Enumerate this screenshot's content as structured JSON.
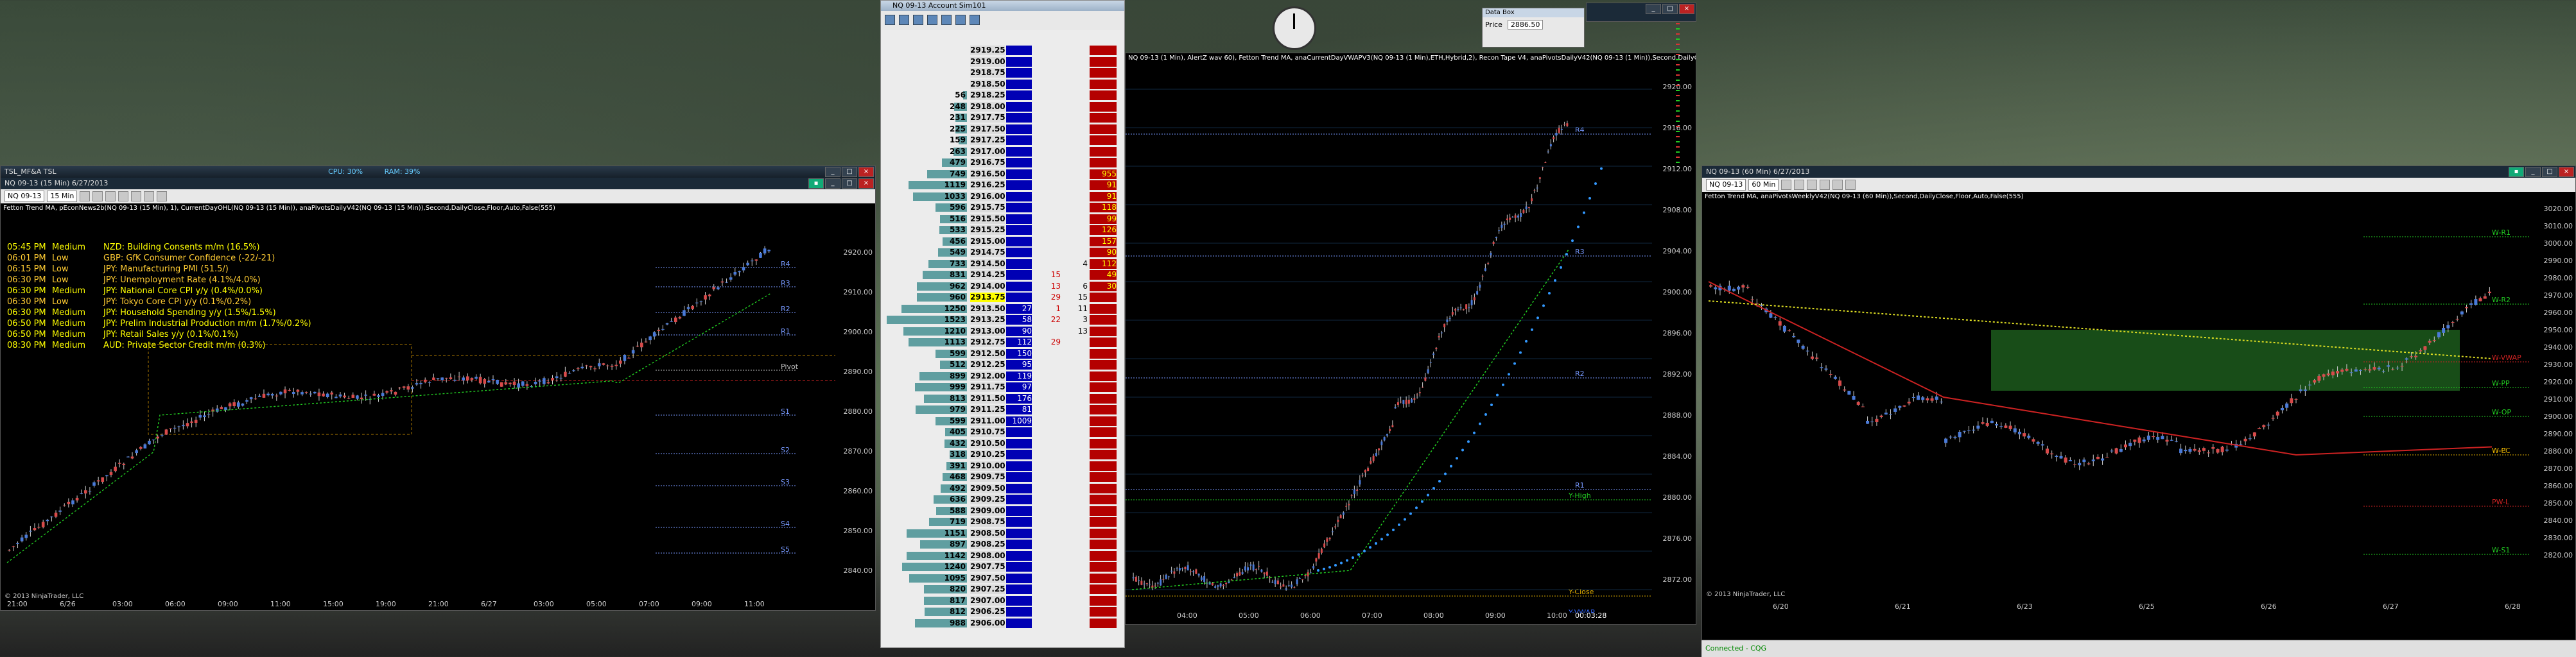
{
  "left_window": {
    "title": "NQ 09-13 (15 Min)  6/27/2013",
    "top_bar_left": "TSL_MF&A TSL",
    "top_bar_stat1": "CPU: 30%",
    "top_bar_stat2": "RAM: 39%",
    "instrument": "NQ 09-13",
    "interval": "15 Min",
    "indicators": "Fetton Trend MA, pEconNews2b(NQ 09-13 (15 Min), 1), CurrentDayOHL(NQ 09-13 (15 Min)), anaPivotsDailyV42(NQ 09-13 (15 Min)),Second,DailyClose,Floor,Auto,False(555)",
    "news": [
      {
        "time": "05:45 PM",
        "impact": "Medium",
        "event": "NZD: Building Consents m/m (16.5%)"
      },
      {
        "time": "06:01 PM",
        "impact": "Low",
        "event": "GBP: GfK Consumer Confidence (-22/-21)"
      },
      {
        "time": "06:15 PM",
        "impact": "Low",
        "event": "JPY: Manufacturing PMI (51.5/)"
      },
      {
        "time": "06:30 PM",
        "impact": "Low",
        "event": "JPY: Unemployment Rate (4.1%/4.0%)"
      },
      {
        "time": "06:30 PM",
        "impact": "Medium",
        "event": "JPY: National Core CPI y/y (0.4%/0.0%)"
      },
      {
        "time": "06:30 PM",
        "impact": "Low",
        "event": "JPY: Tokyo Core CPI y/y (0.1%/0.2%)"
      },
      {
        "time": "06:30 PM",
        "impact": "Medium",
        "event": "JPY: Household Spending y/y (1.5%/1.5%)"
      },
      {
        "time": "06:50 PM",
        "impact": "Medium",
        "event": "JPY: Prelim Industrial Production m/m (1.7%/0.2%)"
      },
      {
        "time": "06:50 PM",
        "impact": "Medium",
        "event": "JPY: Retail Sales y/y (0.1%/0.1%)"
      },
      {
        "time": "08:30 PM",
        "impact": "Medium",
        "event": "AUD: Private Sector Credit m/m (0.3%)"
      }
    ],
    "levels": [
      "R4",
      "R3",
      "R2",
      "R1",
      "Pivot",
      "S1",
      "S2",
      "S3",
      "S4",
      "S5"
    ],
    "copyright": "© 2013 NinjaTrader, LLC",
    "time_labels": [
      "21:00",
      "6/26",
      "03:00",
      "06:00",
      "09:00",
      "11:00",
      "15:00",
      "19:00",
      "21:00",
      "6/27",
      "03:00",
      "05:00",
      "07:00",
      "09:00",
      "11:00"
    ],
    "price_labels": [
      "2920.00",
      "2910.00",
      "2900.00",
      "2890.00",
      "2880.00",
      "2870.00",
      "2860.00",
      "2850.00",
      "2840.00"
    ]
  },
  "ladder": {
    "title": "NQ 09-13  Account Sim101",
    "rows": [
      {
        "vol": "",
        "price": "2919.25",
        "bid": "",
        "ask": "",
        "m1": "",
        "m2": "",
        "w": 0
      },
      {
        "vol": "",
        "price": "2919.00",
        "bid": "",
        "ask": "",
        "m1": "",
        "m2": "",
        "w": 0
      },
      {
        "vol": "",
        "price": "2918.75",
        "bid": "",
        "ask": "",
        "m1": "",
        "m2": "",
        "w": 0
      },
      {
        "vol": "",
        "price": "2918.50",
        "bid": "",
        "ask": "",
        "m1": "",
        "m2": "",
        "w": 0
      },
      {
        "vol": "56",
        "price": "2918.25",
        "bid": "",
        "ask": "",
        "m1": "",
        "m2": "",
        "w": 4
      },
      {
        "vol": "248",
        "price": "2918.00",
        "bid": "",
        "ask": "",
        "m1": "",
        "m2": "",
        "w": 14
      },
      {
        "vol": "231",
        "price": "2917.75",
        "bid": "",
        "ask": "",
        "m1": "",
        "m2": "",
        "w": 13
      },
      {
        "vol": "225",
        "price": "2917.50",
        "bid": "",
        "ask": "",
        "m1": "",
        "m2": "",
        "w": 13
      },
      {
        "vol": "159",
        "price": "2917.25",
        "bid": "",
        "ask": "",
        "m1": "",
        "m2": "",
        "w": 9
      },
      {
        "vol": "263",
        "price": "2917.00",
        "bid": "",
        "ask": "",
        "m1": "",
        "m2": "",
        "w": 15
      },
      {
        "vol": "479",
        "price": "2916.75",
        "bid": "",
        "ask": "",
        "m1": "",
        "m2": "",
        "w": 28
      },
      {
        "vol": "749",
        "price": "2916.50",
        "bid": "",
        "ask": "955",
        "m1": "",
        "m2": "",
        "w": 44
      },
      {
        "vol": "1119",
        "price": "2916.25",
        "bid": "",
        "ask": "91",
        "m1": "",
        "m2": "",
        "w": 65
      },
      {
        "vol": "1033",
        "price": "2916.00",
        "bid": "",
        "ask": "91",
        "m1": "",
        "m2": "",
        "w": 60
      },
      {
        "vol": "596",
        "price": "2915.75",
        "bid": "",
        "ask": "118",
        "m1": "",
        "m2": "",
        "w": 35
      },
      {
        "vol": "516",
        "price": "2915.50",
        "bid": "",
        "ask": "99",
        "m1": "",
        "m2": "",
        "w": 30
      },
      {
        "vol": "533",
        "price": "2915.25",
        "bid": "",
        "ask": "126",
        "m1": "",
        "m2": "",
        "w": 31
      },
      {
        "vol": "456",
        "price": "2915.00",
        "bid": "",
        "ask": "157",
        "m1": "",
        "m2": "",
        "w": 27
      },
      {
        "vol": "549",
        "price": "2914.75",
        "bid": "",
        "ask": "90",
        "m1": "",
        "m2": "",
        "w": 32
      },
      {
        "vol": "733",
        "price": "2914.50",
        "bid": "",
        "ask": "112",
        "m1": "",
        "m2": "4",
        "w": 43
      },
      {
        "vol": "831",
        "price": "2914.25",
        "bid": "",
        "ask": "49",
        "m1": "15",
        "m2": "",
        "w": 49
      },
      {
        "vol": "962",
        "price": "2914.00",
        "bid": "",
        "ask": "30",
        "m1": "13",
        "m2": "6",
        "w": 56
      },
      {
        "vol": "960",
        "price": "2913.75",
        "bid": "",
        "ask": "",
        "m1": "29",
        "m2": "15",
        "w": 56
      },
      {
        "vol": "1250",
        "price": "2913.50",
        "bid": "27",
        "ask": "",
        "m1": "1",
        "m2": "11",
        "w": 73
      },
      {
        "vol": "1523",
        "price": "2913.25",
        "bid": "58",
        "ask": "",
        "m1": "22",
        "m2": "3",
        "w": 89
      },
      {
        "vol": "1210",
        "price": "2913.00",
        "bid": "90",
        "ask": "",
        "m1": "",
        "m2": "13",
        "w": 71
      },
      {
        "vol": "1113",
        "price": "2912.75",
        "bid": "112",
        "ask": "",
        "m1": "29",
        "m2": "",
        "w": 65
      },
      {
        "vol": "599",
        "price": "2912.50",
        "bid": "150",
        "ask": "",
        "m1": "",
        "m2": "",
        "w": 35
      },
      {
        "vol": "512",
        "price": "2912.25",
        "bid": "95",
        "ask": "",
        "m1": "",
        "m2": "",
        "w": 30
      },
      {
        "vol": "899",
        "price": "2912.00",
        "bid": "119",
        "ask": "",
        "m1": "",
        "m2": "",
        "w": 53
      },
      {
        "vol": "999",
        "price": "2911.75",
        "bid": "97",
        "ask": "",
        "m1": "",
        "m2": "",
        "w": 58
      },
      {
        "vol": "813",
        "price": "2911.50",
        "bid": "176",
        "ask": "",
        "m1": "",
        "m2": "",
        "w": 48
      },
      {
        "vol": "979",
        "price": "2911.25",
        "bid": "81",
        "ask": "",
        "m1": "",
        "m2": "",
        "w": 57
      },
      {
        "vol": "599",
        "price": "2911.00",
        "bid": "1009",
        "ask": "",
        "m1": "",
        "m2": "",
        "w": 35
      },
      {
        "vol": "405",
        "price": "2910.75",
        "bid": "",
        "ask": "",
        "m1": "",
        "m2": "",
        "w": 24
      },
      {
        "vol": "432",
        "price": "2910.50",
        "bid": "",
        "ask": "",
        "m1": "",
        "m2": "",
        "w": 25
      },
      {
        "vol": "318",
        "price": "2910.25",
        "bid": "",
        "ask": "",
        "m1": "",
        "m2": "",
        "w": 19
      },
      {
        "vol": "391",
        "price": "2910.00",
        "bid": "",
        "ask": "",
        "m1": "",
        "m2": "",
        "w": 23
      },
      {
        "vol": "468",
        "price": "2909.75",
        "bid": "",
        "ask": "",
        "m1": "",
        "m2": "",
        "w": 27
      },
      {
        "vol": "492",
        "price": "2909.50",
        "bid": "",
        "ask": "",
        "m1": "",
        "m2": "",
        "w": 29
      },
      {
        "vol": "636",
        "price": "2909.25",
        "bid": "",
        "ask": "",
        "m1": "",
        "m2": "",
        "w": 37
      },
      {
        "vol": "588",
        "price": "2909.00",
        "bid": "",
        "ask": "",
        "m1": "",
        "m2": "",
        "w": 34
      },
      {
        "vol": "719",
        "price": "2908.75",
        "bid": "",
        "ask": "",
        "m1": "",
        "m2": "",
        "w": 42
      },
      {
        "vol": "1151",
        "price": "2908.50",
        "bid": "",
        "ask": "",
        "m1": "",
        "m2": "",
        "w": 67
      },
      {
        "vol": "897",
        "price": "2908.25",
        "bid": "",
        "ask": "",
        "m1": "",
        "m2": "",
        "w": 52
      },
      {
        "vol": "1142",
        "price": "2908.00",
        "bid": "",
        "ask": "",
        "m1": "",
        "m2": "",
        "w": 67
      },
      {
        "vol": "1240",
        "price": "2907.75",
        "bid": "",
        "ask": "",
        "m1": "",
        "m2": "",
        "w": 72
      },
      {
        "vol": "1095",
        "price": "2907.50",
        "bid": "",
        "ask": "",
        "m1": "",
        "m2": "",
        "w": 64
      },
      {
        "vol": "820",
        "price": "2907.25",
        "bid": "",
        "ask": "",
        "m1": "",
        "m2": "",
        "w": 48
      },
      {
        "vol": "817",
        "price": "2907.00",
        "bid": "",
        "ask": "",
        "m1": "",
        "m2": "",
        "w": 48
      },
      {
        "vol": "812",
        "price": "2906.25",
        "bid": "",
        "ask": "",
        "m1": "",
        "m2": "",
        "w": 47
      },
      {
        "vol": "988",
        "price": "2906.00",
        "bid": "",
        "ask": "",
        "m1": "",
        "m2": "",
        "w": 58
      }
    ]
  },
  "center_window": {
    "title": "NQ 09-13 (1 Min)",
    "indicators": "NQ 09-13 (1 Min), AlertZ wav 60), Fetton Trend MA, anaCurrentDayVWAPV3(NQ 09-13 (1 Min),ETH,Hybrid,2), Recon Tape V4, anaPivotsDailyV42(NQ 09-13 (1 Min)),Second,DailyClose,Floor,Auto,False(555)",
    "levels": [
      "R4",
      "R3",
      "R2",
      "R1",
      "Y-High",
      "Y-Close",
      "Y-VWAP"
    ],
    "price_labels": [
      "2920.00",
      "2916.00",
      "2912.00",
      "2908.00",
      "2904.00",
      "2900.00",
      "2896.00",
      "2892.00",
      "2888.00",
      "2884.00",
      "2880.00",
      "2876.00",
      "2872.00"
    ],
    "time_labels": [
      "04:00",
      "05:00",
      "06:00",
      "07:00",
      "08:00",
      "09:00",
      "10:00"
    ],
    "countdown": "00:03:28"
  },
  "data_box": {
    "title": "Data Box",
    "label": "Price",
    "value": "2886.50"
  },
  "right_window": {
    "title": "NQ 09-13 (60 Min)  6/27/2013",
    "instrument": "NQ 09-13",
    "interval": "60 Min",
    "indicators": "Fetton Trend MA, anaPivotsWeeklyV42(NQ 09-13 (60 Min)),Second,DailyClose,Floor,Auto,False(555)",
    "levels": [
      "W-R1",
      "W-R2",
      "W-VWAP",
      "W-PP",
      "W-OP",
      "W-PC",
      "W-C",
      "PW-L",
      "W-S1"
    ],
    "price_labels": [
      "3020.00",
      "3010.00",
      "3000.00",
      "2990.00",
      "2980.00",
      "2970.00",
      "2960.00",
      "2950.00",
      "2940.00",
      "2930.00",
      "2920.00",
      "2910.00",
      "2900.00",
      "2890.00",
      "2880.00",
      "2870.00",
      "2860.00",
      "2850.00",
      "2840.00",
      "2830.00",
      "2820.00"
    ],
    "time_labels": [
      "6/20",
      "6/21",
      "6/23",
      "6/25",
      "6/26",
      "6/27",
      "6/28"
    ],
    "copyright": "© 2013 NinjaTrader, LLC"
  },
  "statusbar": {
    "status": "Connected - CQG"
  }
}
